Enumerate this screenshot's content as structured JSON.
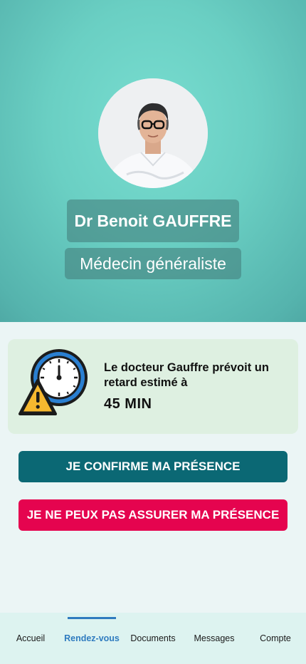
{
  "doctor": {
    "name": "Dr Benoit GAUFFRE",
    "specialty": "Médecin généraliste"
  },
  "alert": {
    "message": "Le docteur Gauffre prévoit un retard estimé à",
    "delay": "45 MIN",
    "icon": "clock-warning-icon"
  },
  "actions": {
    "confirm_label": "JE CONFIRME MA PRÉSENCE",
    "decline_label": "JE NE PEUX PAS ASSURER MA PRÉSENCE"
  },
  "nav": {
    "items": [
      {
        "label": "Accueil"
      },
      {
        "label": "Rendez-vous"
      },
      {
        "label": "Documents"
      },
      {
        "label": "Messages"
      },
      {
        "label": "Compte"
      }
    ],
    "active": "Rendez-vous"
  },
  "colors": {
    "confirm": "#0b6874",
    "decline": "#e5044f",
    "active_nav": "#2f7bbf",
    "hero": "#6acfc3"
  }
}
